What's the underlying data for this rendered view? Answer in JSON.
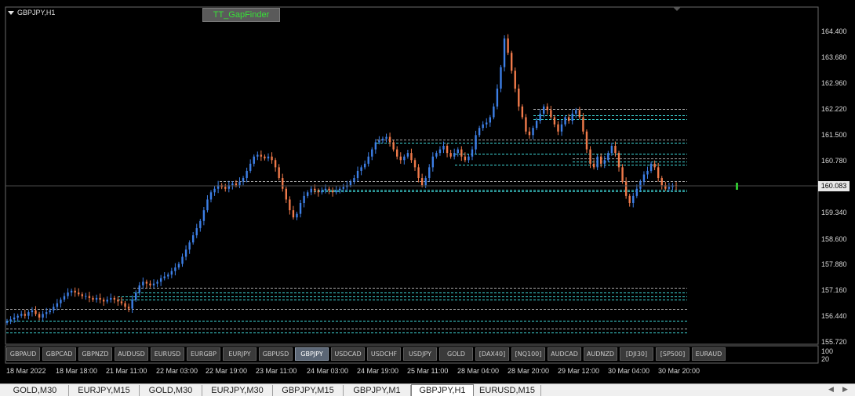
{
  "chart": {
    "symbol_label": "GBPJPY,H1",
    "indicator_button": "TT_GapFinder",
    "current_price": "160.083",
    "y_axis": [
      {
        "label": "164.400",
        "value": 164.4
      },
      {
        "label": "163.680",
        "value": 163.68
      },
      {
        "label": "162.960",
        "value": 162.96
      },
      {
        "label": "162.220",
        "value": 162.22
      },
      {
        "label": "161.500",
        "value": 161.5
      },
      {
        "label": "160.780",
        "value": 160.78
      },
      {
        "label": "160.083",
        "value": 160.083
      },
      {
        "label": "159.340",
        "value": 159.34
      },
      {
        "label": "158.600",
        "value": 158.6
      },
      {
        "label": "157.880",
        "value": 157.88
      },
      {
        "label": "157.160",
        "value": 157.16
      },
      {
        "label": "156.440",
        "value": 156.44
      },
      {
        "label": "155.720",
        "value": 155.72
      }
    ],
    "x_axis": [
      "18 Mar 2022",
      "18 Mar 18:00",
      "21 Mar 11:00",
      "22 Mar 03:00",
      "22 Mar 19:00",
      "23 Mar 11:00",
      "24 Mar 03:00",
      "24 Mar 19:00",
      "25 Mar 11:00",
      "28 Mar 04:00",
      "28 Mar 20:00",
      "29 Mar 12:00",
      "30 Mar 04:00",
      "30 Mar 20:00"
    ],
    "volume_scale": [
      "100",
      "20"
    ],
    "colors": {
      "bull": "#3d7fe6",
      "bear": "#f07a4a",
      "gap_gray": "#a8a8a8",
      "gap_cyan": "#3fd8d8",
      "grid": "#3a3a3a",
      "background": "#000000",
      "current_marker": "#30c030"
    }
  },
  "symbol_buttons": [
    "GBPAUD",
    "GBPCAD",
    "GBPNZD",
    "AUDUSD",
    "EURUSD",
    "EURGBP",
    "EURJPY",
    "GBPUSD",
    "GBPJPY",
    "USDCAD",
    "USDCHF",
    "USDJPY",
    "GOLD",
    "[DAX40]",
    "[NQ100]",
    "AUDCAD",
    "AUDNZD",
    "[DJI30]",
    "[SP500]",
    "EURAUD"
  ],
  "active_symbol": "GBPJPY",
  "tabs": [
    "GOLD,M30",
    "EURJPY,M15",
    "GOLD,M30",
    "EURJPY,M30",
    "GBPJPY,M15",
    "GBPJPY,M1",
    "GBPJPY,H1",
    "EURUSD,M15"
  ],
  "active_tab": "GBPJPY,H1",
  "chart_data": {
    "type": "candlestick",
    "series": [
      {
        "name": "GBPJPY,H1",
        "values": [
          156.3,
          156.35,
          156.4,
          156.45,
          156.5,
          156.45,
          156.55,
          156.6,
          156.5,
          156.4,
          156.5,
          156.55,
          156.6,
          156.7,
          156.8,
          156.9,
          157.0,
          157.1,
          157.15,
          157.1,
          157.05,
          157.0,
          157.0,
          156.95,
          156.9,
          156.95,
          156.9,
          156.85,
          156.9,
          156.95,
          156.9,
          156.85,
          156.8,
          156.7,
          156.65,
          156.9,
          157.1,
          157.3,
          157.4,
          157.35,
          157.3,
          157.35,
          157.4,
          157.5,
          157.55,
          157.6,
          157.7,
          157.8,
          157.9,
          158.1,
          158.3,
          158.5,
          158.7,
          158.9,
          159.1,
          159.4,
          159.7,
          159.9,
          160.0,
          160.1,
          160.05,
          160.0,
          160.1,
          160.15,
          160.1,
          160.2,
          160.3,
          160.5,
          160.7,
          160.9,
          160.95,
          160.9,
          160.85,
          160.9,
          160.8,
          160.6,
          160.3,
          160.0,
          159.7,
          159.4,
          159.2,
          159.3,
          159.6,
          159.8,
          159.9,
          160.0,
          159.95,
          159.9,
          159.95,
          160.0,
          159.95,
          159.9,
          159.95,
          160.0,
          160.05,
          160.1,
          160.2,
          160.3,
          160.5,
          160.6,
          160.7,
          160.9,
          161.1,
          161.3,
          161.35,
          161.4,
          161.45,
          161.3,
          161.1,
          160.9,
          160.8,
          160.9,
          161.0,
          160.8,
          160.6,
          160.3,
          160.1,
          160.3,
          160.6,
          160.9,
          161.0,
          161.1,
          161.2,
          161.0,
          160.9,
          161.0,
          161.1,
          160.9,
          160.8,
          160.9,
          161.1,
          161.5,
          161.7,
          161.8,
          161.85,
          162.0,
          162.3,
          162.8,
          163.4,
          164.2,
          163.8,
          163.3,
          162.8,
          162.3,
          162.0,
          161.6,
          161.5,
          161.7,
          161.9,
          162.1,
          162.3,
          162.2,
          162.0,
          161.8,
          161.6,
          161.8,
          162.0,
          161.9,
          162.1,
          162.2,
          162.0,
          161.6,
          161.1,
          160.7,
          160.6,
          160.9,
          160.7,
          160.8,
          161.0,
          161.2,
          161.0,
          160.6,
          160.2,
          159.8,
          159.6,
          159.8,
          160.0,
          160.2,
          160.4,
          160.5,
          160.7,
          160.6,
          160.3,
          160.1,
          160.0,
          160.05,
          160.1,
          160.08
        ]
      }
    ],
    "ylim": [
      155.5,
      164.7
    ],
    "gap_levels": {
      "gray": [
        162.23,
        161.38,
        160.86,
        160.22,
        157.23,
        156.63,
        156.09
      ],
      "cyan": [
        162.05,
        161.95,
        161.28,
        160.99,
        160.77,
        160.67,
        159.97,
        159.92,
        157.1,
        157.0,
        156.91,
        156.32,
        155.98
      ]
    }
  }
}
